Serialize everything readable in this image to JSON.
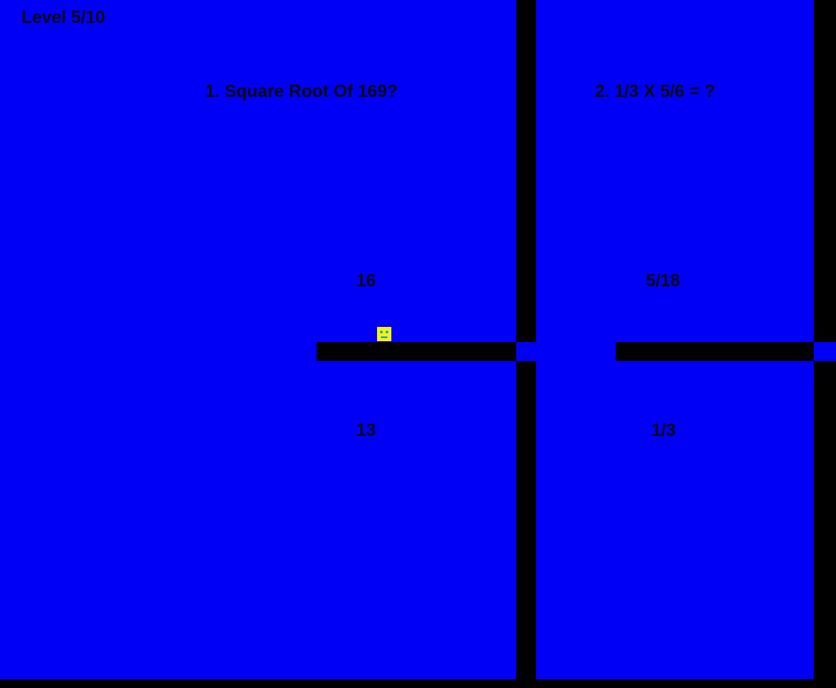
{
  "hud": {
    "level": "Level 5/10"
  },
  "questions": [
    {
      "prompt": "1. Square Root Of 169?",
      "answer_top": "16",
      "answer_bottom": "13"
    },
    {
      "prompt": "2. 1/3 X 5/6 = ?",
      "answer_top": "5/18",
      "answer_bottom": "1/3"
    }
  ],
  "colors": {
    "background": "#0000f6",
    "wall": "#000000",
    "player": "#f2f21a",
    "text": "#0a0a14"
  },
  "player": {
    "icon": "smiley-block-icon"
  }
}
